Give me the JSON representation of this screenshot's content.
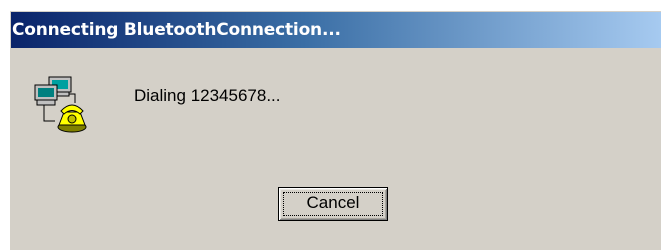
{
  "window": {
    "title": "Connecting BluetoothConnection..."
  },
  "status": {
    "message": "Dialing 12345678...",
    "icon": "dialup-connection-icon"
  },
  "buttons": {
    "cancel_label": "Cancel"
  },
  "colors": {
    "titlebar_start": "#0a246a",
    "titlebar_end": "#a6caf0",
    "face": "#d4d0c8"
  }
}
